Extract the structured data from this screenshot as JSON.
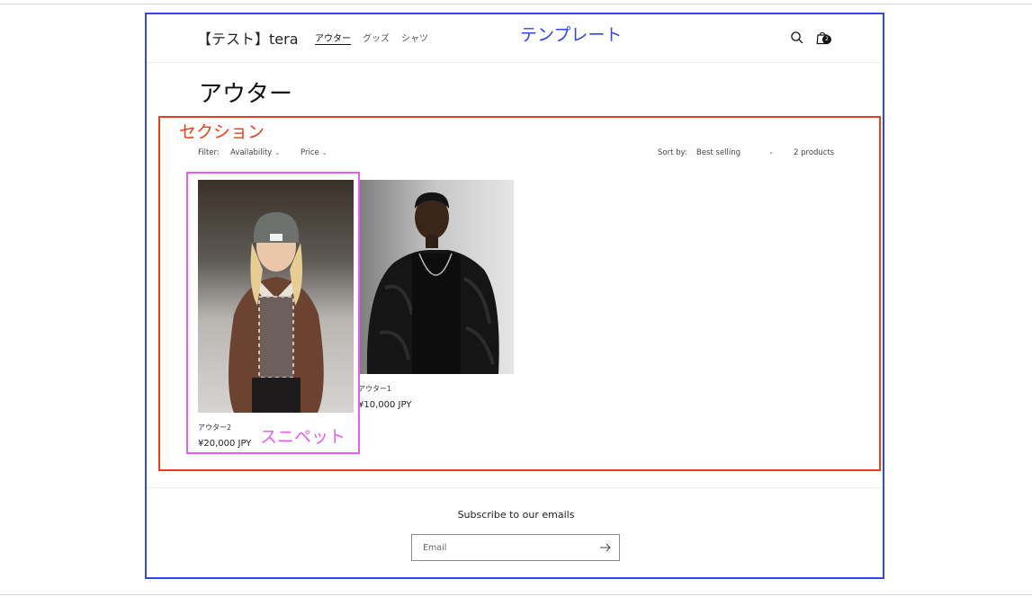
{
  "annotations": {
    "template_label": "テンプレート",
    "section_label": "セクション",
    "snippet_label": "スニペット",
    "template_color": "#3347e8",
    "section_color": "#e8401d",
    "snippet_color": "#e85cf0"
  },
  "header": {
    "logo": "【テスト】tera",
    "nav": [
      {
        "label": "アウター",
        "active": true
      },
      {
        "label": "グッズ",
        "active": false
      },
      {
        "label": "シャツ",
        "active": false
      }
    ],
    "search_icon": "search-icon",
    "cart_icon": "cart-icon",
    "cart_count": "2"
  },
  "collection": {
    "title": "アウター",
    "filter_label": "Filter:",
    "filters": [
      "Availability",
      "Price"
    ],
    "sort_label": "Sort by:",
    "sort_value": "Best selling",
    "product_count": "2 products"
  },
  "products": [
    {
      "title": "アウター2",
      "price": "¥20,000 JPY"
    },
    {
      "title": "アウター1",
      "price": "¥10,000 JPY"
    }
  ],
  "newsletter": {
    "title": "Subscribe to our emails",
    "email_placeholder": "Email",
    "submit_icon": "arrow-right-icon"
  }
}
